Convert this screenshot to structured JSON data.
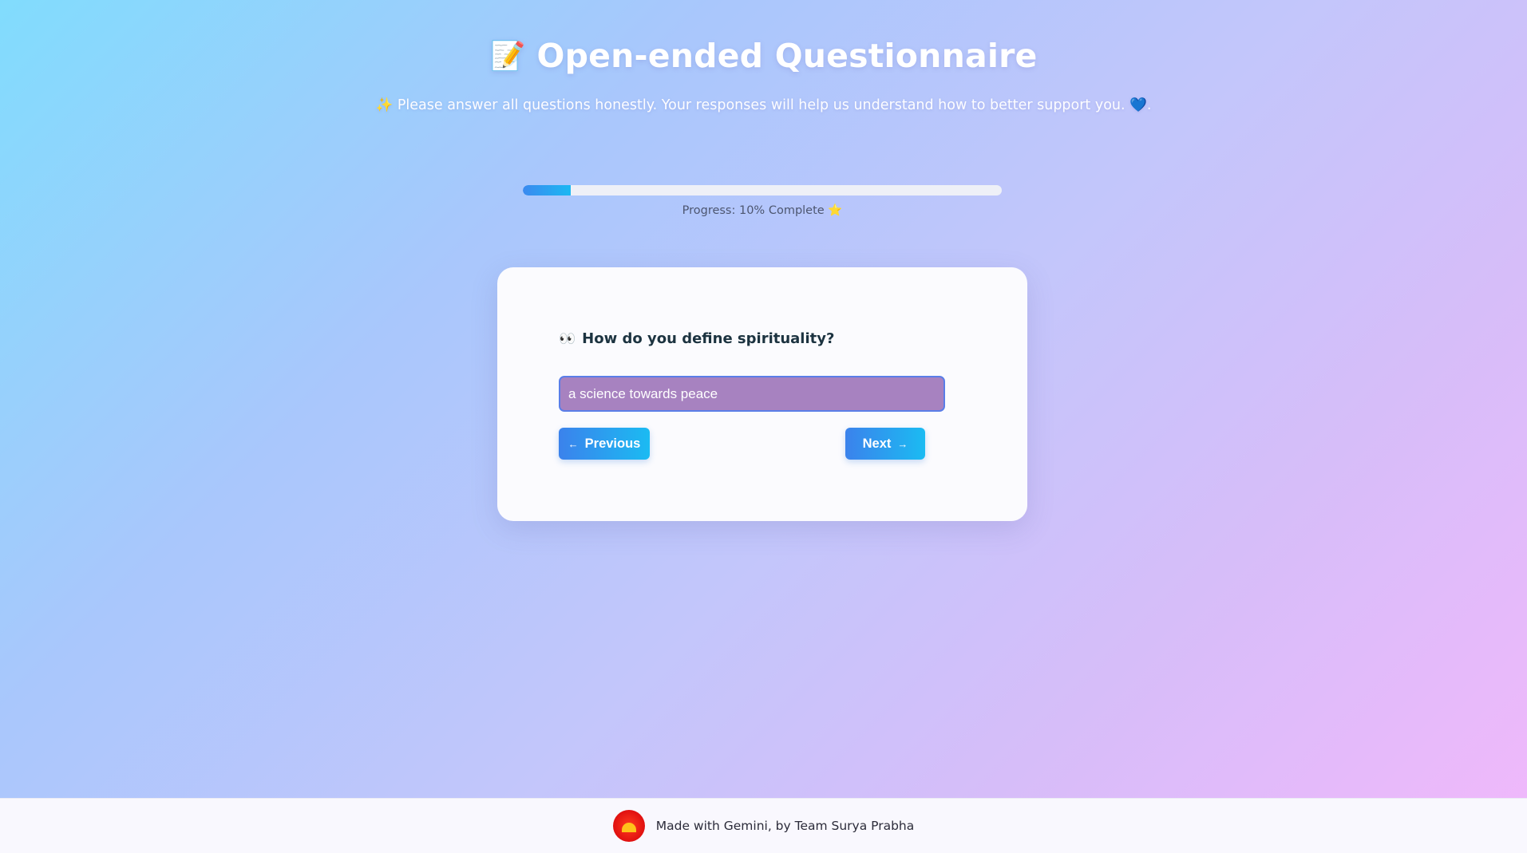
{
  "header": {
    "title_icon": "📝",
    "title": "Open-ended Questionnaire",
    "subtitle": "✨ Please answer all questions honestly. Your responses will help us understand how to better support you. 💙."
  },
  "progress": {
    "percent": 10,
    "label": "Progress: 10% Complete ⭐"
  },
  "question": {
    "icon": "👀",
    "text": "How do you define spirituality?",
    "answer_value": "a science towards peace "
  },
  "buttons": {
    "previous_arrow": "←",
    "previous_label": "Previous",
    "next_label": "Next",
    "next_arrow": "→"
  },
  "footer": {
    "logo": "sun-logo-icon",
    "text": "Made with Gemini, by Team Surya Prabha"
  },
  "colors": {
    "accent": "#3b82ec",
    "accent_end": "#1bbbf2",
    "input_bg": "#a782c0"
  }
}
